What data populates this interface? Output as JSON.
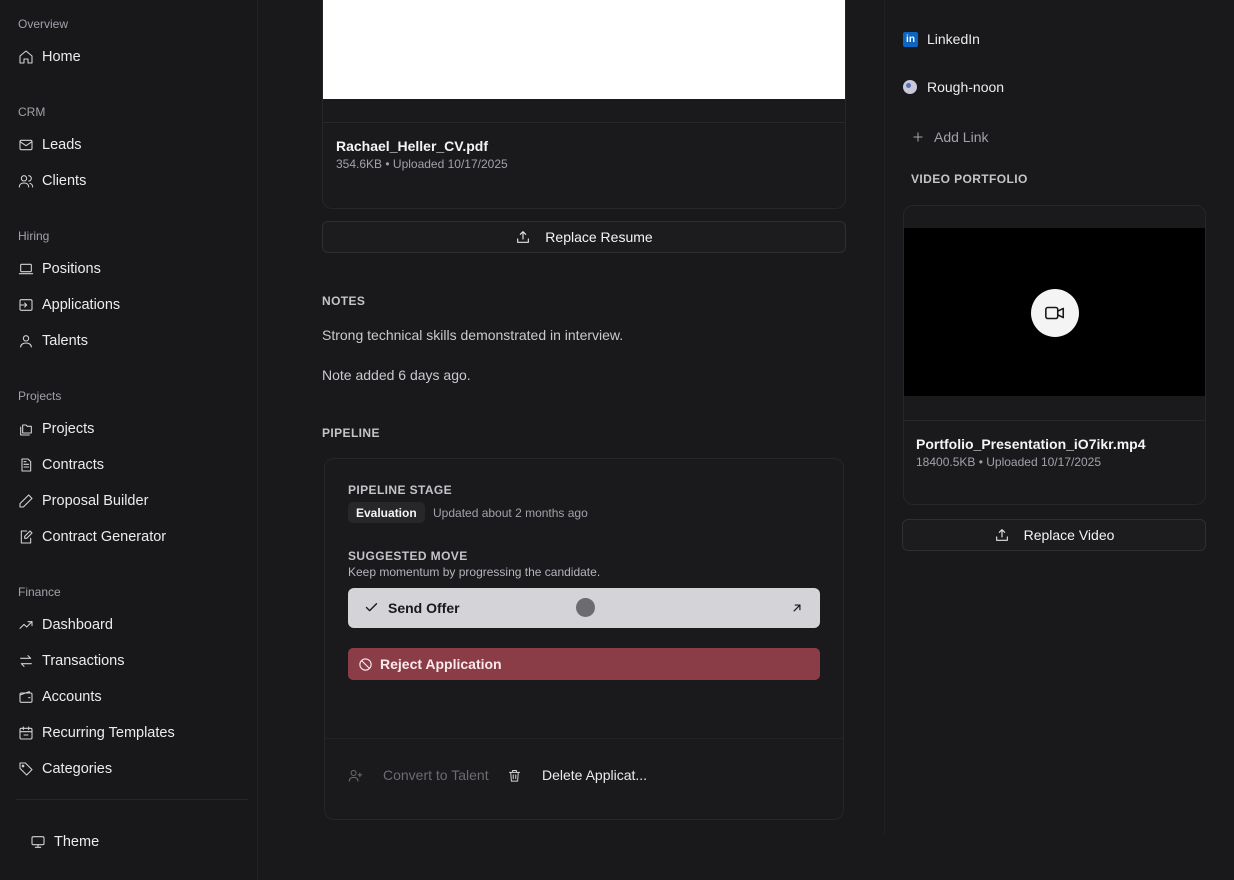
{
  "sidebar": {
    "groups": {
      "overview": "Overview",
      "crm": "CRM",
      "hiring": "Hiring",
      "projects": "Projects",
      "finance": "Finance"
    },
    "items": {
      "home": "Home",
      "leads": "Leads",
      "clients": "Clients",
      "positions": "Positions",
      "applications": "Applications",
      "talents": "Talents",
      "projects": "Projects",
      "contracts": "Contracts",
      "proposal_builder": "Proposal Builder",
      "contract_generator": "Contract Generator",
      "dashboard": "Dashboard",
      "transactions": "Transactions",
      "accounts": "Accounts",
      "recurring_templates": "Recurring Templates",
      "categories": "Categories"
    },
    "theme": "Theme"
  },
  "resume": {
    "file_name": "Rachael_Heller_CV.pdf",
    "file_meta": "354.6KB • Uploaded 10/17/2025",
    "replace_label": "Replace Resume"
  },
  "notes": {
    "title": "NOTES",
    "text": "Strong technical skills demonstrated in interview.",
    "added": "Note added 6 days ago."
  },
  "pipeline": {
    "title": "PIPELINE",
    "stage_label": "PIPELINE STAGE",
    "stage_value": "Evaluation",
    "stage_updated": "Updated about 2 months ago",
    "suggested_label": "SUGGESTED MOVE",
    "suggested_hint": "Keep momentum by progressing the candidate.",
    "send_offer": "Send Offer",
    "reject": "Reject Application",
    "convert": "Convert to Talent",
    "delete": "Delete Applicat..."
  },
  "links": {
    "linkedin": "LinkedIn",
    "website": "Rough-noon",
    "add_link": "Add Link"
  },
  "video": {
    "title": "VIDEO PORTFOLIO",
    "file_name": "Portfolio_Presentation_iO7ikr.mp4",
    "file_meta": "18400.5KB • Uploaded 10/17/2025",
    "replace_label": "Replace Video"
  },
  "colors": {
    "background": "#19191c",
    "reject": "#8a3d47",
    "primary_button": "#d4d4d8",
    "linkedin": "#0a66c2"
  }
}
